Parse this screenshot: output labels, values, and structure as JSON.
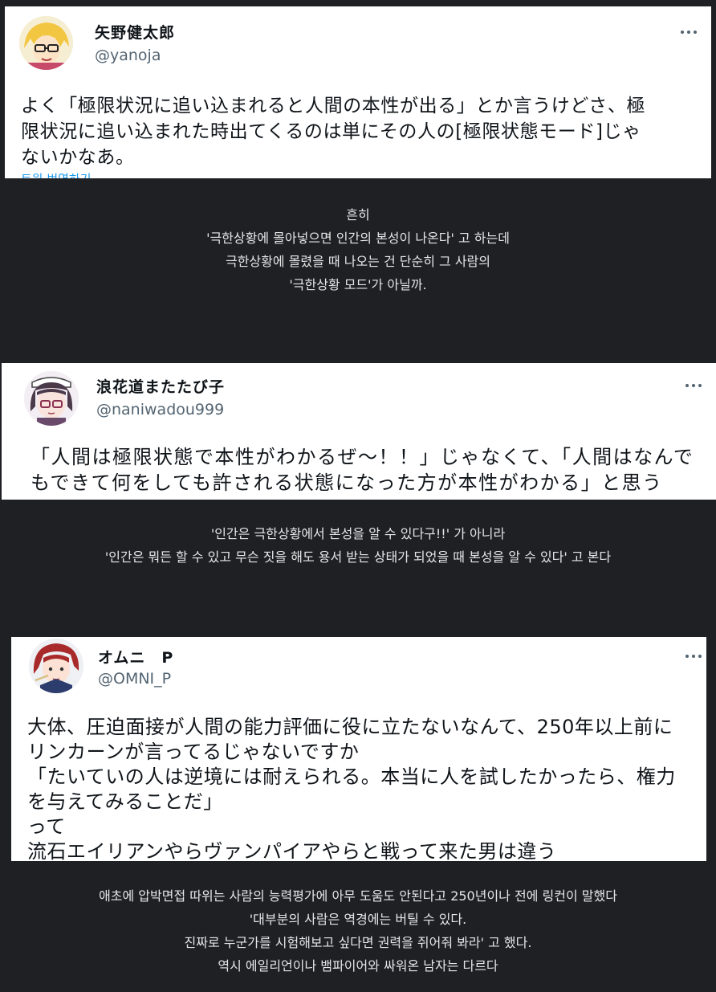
{
  "tweets": [
    {
      "display_name": "矢野健太郎",
      "handle": "@yanoja",
      "lines": [
        "よく「極限状況に追い込まれると人間の本性が出る」とか言うけどさ、極",
        "限状況に追い込まれた時出てくるのは単にその人の[極限状態モード]じゃ",
        "ないかなあ。"
      ],
      "translate_label": "트윗 번역하기"
    },
    {
      "display_name": "浪花道またたび子",
      "handle": "@naniwadou999",
      "lines": [
        "「人間は極限状態で本性がわかるぜ～！！」じゃなくて、「人間はなんで",
        "もできて何をしても許される状態になった方が本性がわかる」と思う"
      ]
    },
    {
      "display_name": "オムニ　P",
      "handle": "@OMNI_P",
      "lines": [
        "大体、圧迫面接が人間の能力評価に役に立たないなんて、250年以上前に",
        "リンカーンが言ってるじゃないですか",
        "「たいていの人は逆境には耐えられる。本当に人を試したかったら、権力",
        "を与えてみることだ」",
        "って",
        "流石エイリアンやらヴァンパイアやらと戦って来た男は違う"
      ]
    }
  ],
  "captions": [
    {
      "lines": [
        "흔히",
        "'극한상황에 몰아넣으면 인간의 본성이 나온다' 고 하는데",
        "극한상황에 몰렸을 때 나오는 건 단순히 그 사람의",
        "'극한상황 모드'가 아닐까."
      ]
    },
    {
      "lines": [
        "'인간은 극한상황에서 본성을 알 수 있다구!!' 가 아니라",
        "'인간은 뭐든 할 수 있고 무슨 짓을 해도 용서 받는 상태가 되었을 때 본성을 알 수 있다' 고 본다"
      ]
    },
    {
      "lines": [
        "애초에 압박면접 따위는 사람의 능력평가에 아무 도움도 안된다고 250년이나 전에 링컨이 말했다",
        "'대부분의 사람은 역경에는 버틸 수 있다.",
        "진짜로 누군가를 시험해보고 싶다면 권력을 쥐어줘 봐라' 고 했다.",
        "역시 에일리언이나 뱀파이어와 싸워온 남자는 다르다"
      ]
    }
  ],
  "colors": {
    "page_background": "#1e2024",
    "card_background": "#ffffff",
    "text_primary": "#0f1419",
    "text_secondary": "#536471",
    "link": "#1d9bf0",
    "caption_text": "#e6e6e6"
  },
  "icons": [
    "more-options-icon"
  ]
}
